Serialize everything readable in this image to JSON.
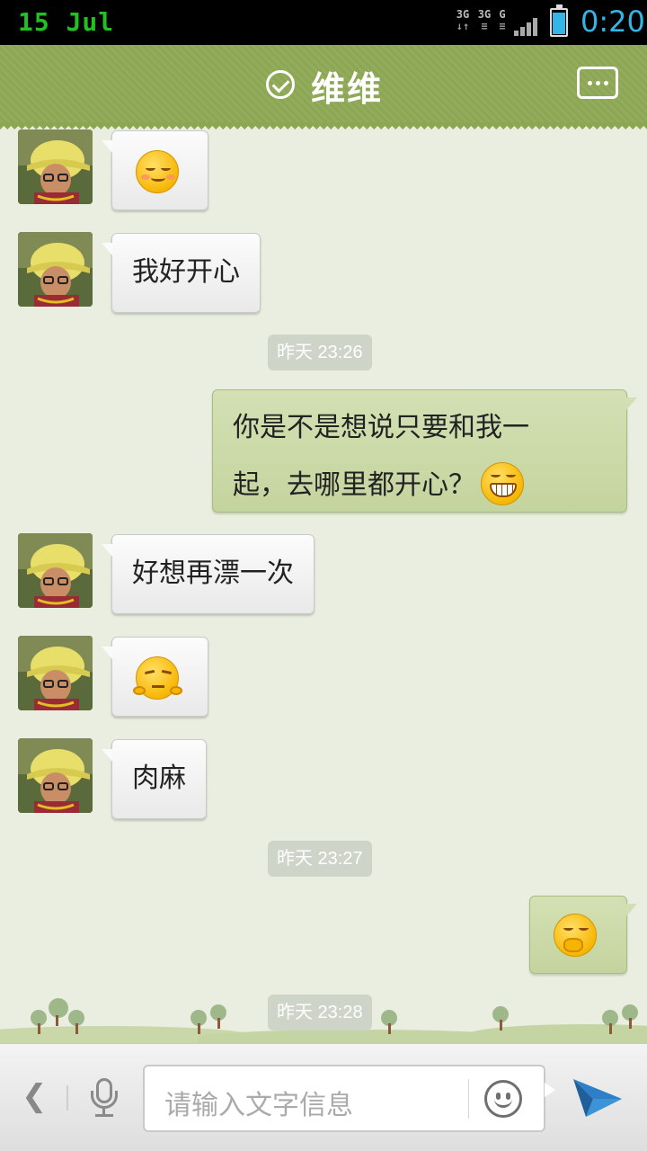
{
  "status_bar": {
    "date": "15 Jul",
    "net1": "3G",
    "net2": "3G",
    "net3": "G",
    "time": "0:20",
    "battery_level": 0.85,
    "colors": {
      "date": "#22c122",
      "time": "#33b5e5"
    }
  },
  "header": {
    "contact_name": "维维",
    "icons": [
      "verified-check-icon",
      "chat-menu-icon"
    ],
    "bg_color": "#8ca753"
  },
  "messages": [
    {
      "dir": "in",
      "emoji": "blushing-smile-emoji"
    },
    {
      "dir": "in",
      "text": "我好开心"
    },
    {
      "type": "timestamp",
      "text": "昨天 23:26"
    },
    {
      "dir": "out",
      "line1": "你是不是想说只要和我一",
      "line2": "起，去哪里都开心？",
      "emoji": "grinning-teeth-emoji"
    },
    {
      "dir": "in",
      "text": "好想再漂一次"
    },
    {
      "dir": "in",
      "emoji": "smug-emoji"
    },
    {
      "dir": "in",
      "text": "肉麻"
    },
    {
      "type": "timestamp",
      "text": "昨天 23:27"
    },
    {
      "dir": "out",
      "emoji": "giggle-covering-mouth-emoji"
    },
    {
      "type": "timestamp",
      "text": "昨天 23:28"
    }
  ],
  "input_bar": {
    "placeholder": "请输入文字信息",
    "back_glyph": "❮",
    "icons": [
      "mic-icon",
      "smiley-icon",
      "send-icon"
    ]
  }
}
